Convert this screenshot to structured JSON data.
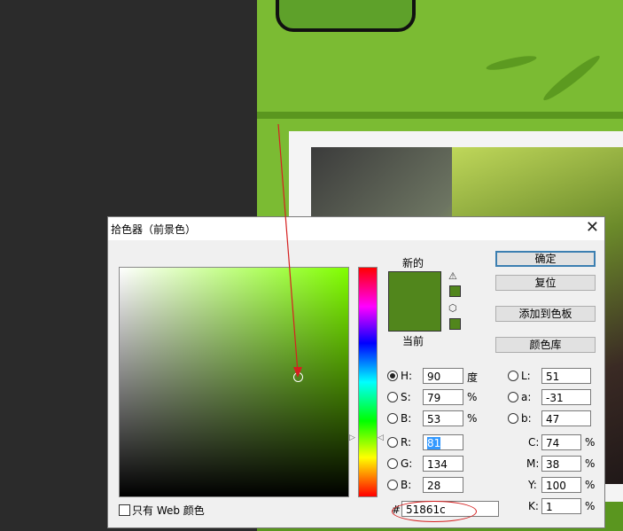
{
  "dialog": {
    "title": "拾色器（前景色）",
    "close_symbol": "✕",
    "new_label": "新的",
    "current_label": "当前",
    "current_color": "#51861c",
    "gamut_warning_icon": "warning-triangle-icon",
    "web_safe_icon": "cube-icon",
    "buttons": {
      "ok": "确定",
      "reset": "复位",
      "add_to_swatches": "添加到色板",
      "color_libraries": "颜色库"
    },
    "fields": {
      "H": {
        "label": "H:",
        "value": "90",
        "unit": "度"
      },
      "S": {
        "label": "S:",
        "value": "79",
        "unit": "%"
      },
      "B": {
        "label": "B:",
        "value": "53",
        "unit": "%"
      },
      "R": {
        "label": "R:",
        "value": "81"
      },
      "G": {
        "label": "G:",
        "value": "134"
      },
      "Bl": {
        "label": "B:",
        "value": "28"
      },
      "L": {
        "label": "L:",
        "value": "51"
      },
      "a": {
        "label": "a:",
        "value": "-31"
      },
      "b": {
        "label": "b:",
        "value": "47"
      },
      "C": {
        "label": "C:",
        "value": "74",
        "unit": "%"
      },
      "M": {
        "label": "M:",
        "value": "38",
        "unit": "%"
      },
      "Y": {
        "label": "Y:",
        "value": "100",
        "unit": "%"
      },
      "K": {
        "label": "K:",
        "value": "1",
        "unit": "%"
      }
    },
    "hex_prefix": "#",
    "hex_value": "51861c",
    "web_only_label": "只有 Web 颜色",
    "hue_color": "#81ff00",
    "annotation_color": "#d62020"
  }
}
